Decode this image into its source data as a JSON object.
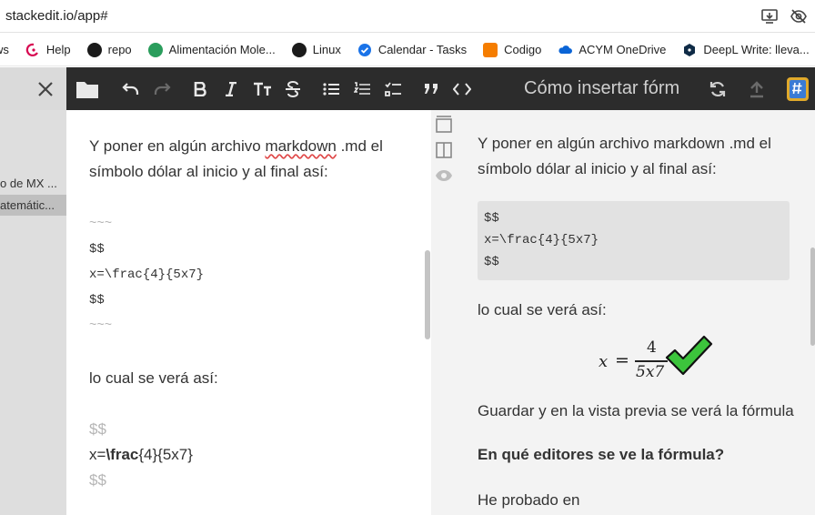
{
  "browser": {
    "url": "stackedit.io/app#",
    "bookmarks": [
      "ws",
      "Help",
      "repo",
      "Alimentación Mole...",
      "Linux",
      "Calendar - Tasks",
      "Codigo",
      "ACYM OneDrive",
      "DeepL Write: lleva..."
    ]
  },
  "app": {
    "document_title": "Cómo insertar fórm"
  },
  "sidebar": {
    "items": [
      "o de MX ...",
      "atemátic..."
    ]
  },
  "editor": {
    "line1": "Y poner en algún archivo ",
    "line1_spell": "markdown",
    "line1_end": " .md el",
    "line2": "símbolo dólar al inicio y al final así:",
    "fence_open": "~~~",
    "code1": "$$",
    "code2": "x=\\frac{4}{5x7}",
    "code3": "$$",
    "fence_close": "~~~",
    "line3": "lo cual se verá así:",
    "math_open": "$$",
    "math_x": "x=",
    "math_frac": "\\frac",
    "math_args": "{4}{5x7}",
    "math_close": "$$"
  },
  "preview": {
    "p1_line1": "Y poner en algún archivo markdown .md el",
    "p1_line2": "símbolo dólar al inicio y al final así:",
    "code": [
      "$$",
      "x=\\frac{4}{5x7}",
      "$$"
    ],
    "p2": "lo cual se verá así:",
    "formula": {
      "lhs": "x",
      "eq": "=",
      "numerator": "4",
      "denominator": "5x7"
    },
    "p3": "Guardar y en la vista previa se verá la fórmula",
    "h": "En qué editores se ve la fórmula?",
    "p4": "He probado en"
  },
  "colors": {
    "toolbar_bg": "#2c2c2c",
    "preview_bg": "#f3f3f3",
    "code_bg": "#e2e2e2",
    "check_green": "#3cc43c"
  }
}
